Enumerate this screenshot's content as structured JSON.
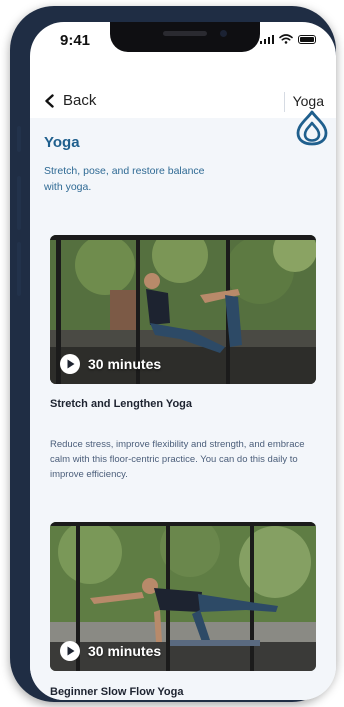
{
  "status_bar": {
    "time": "9:41"
  },
  "nav": {
    "back_label": "Back",
    "title": "Yoga"
  },
  "header": {
    "title": "Yoga",
    "subtitle": "Stretch, pose, and restore balance with yoga."
  },
  "cards": [
    {
      "duration": "30 minutes",
      "title": "Stretch and Lengthen Yoga",
      "description": "Reduce stress, improve flexibility and strength, and embrace calm with this floor-centric practice. You can do this daily to improve efficiency."
    },
    {
      "duration": "30 minutes",
      "title": "Beginner Slow Flow Yoga"
    }
  ],
  "colors": {
    "accent": "#1f5f8d",
    "background": "#f3f6fa",
    "frame": "#1f2d44"
  }
}
